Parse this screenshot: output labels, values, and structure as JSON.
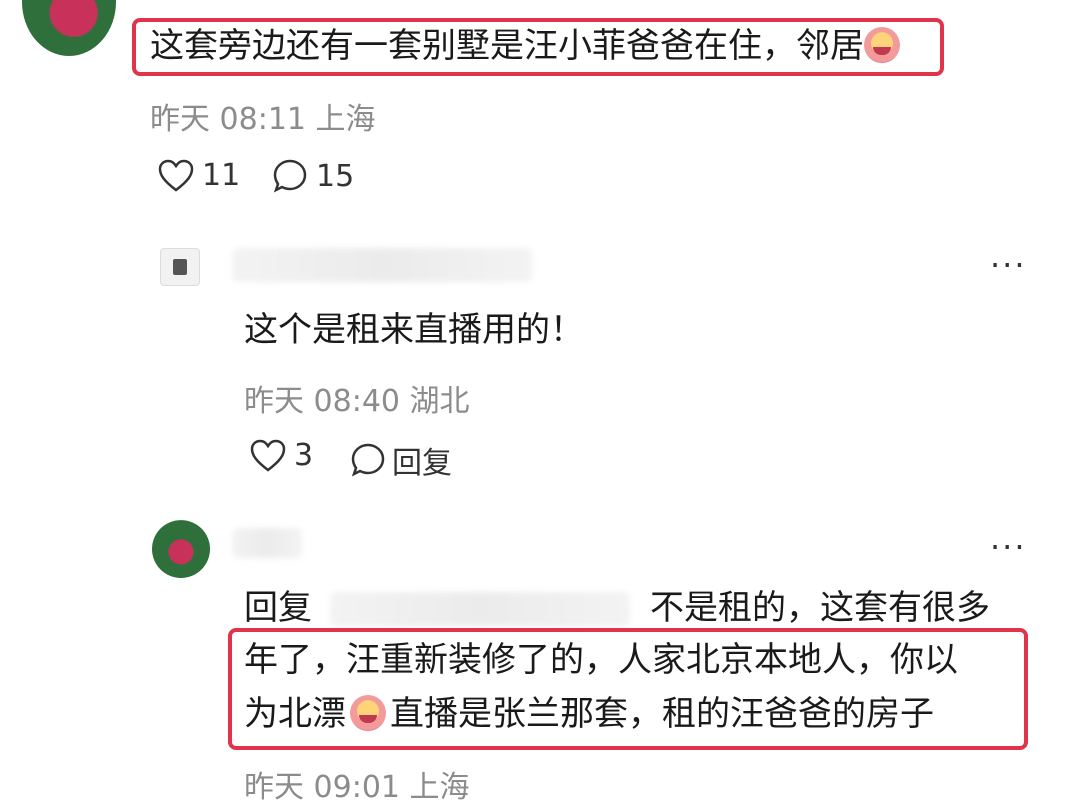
{
  "comment": {
    "text": "这套旁边还有一套别墅是汪小菲爸爸在住，邻居",
    "emoji": "crying-face-emoji",
    "meta": "昨天 08:11 上海",
    "likes": "11",
    "replies": "15"
  },
  "reply1": {
    "text": "这个是租来直播用的！",
    "meta": "昨天 08:40 湖北",
    "likes": "3",
    "reply_label": "回复",
    "more": "···"
  },
  "reply2": {
    "prefix": "回复",
    "line1": "不是租的，这套有很多",
    "line2": "年了，汪重新装修了的，人家北京本地人，你以",
    "line3a": "为北漂",
    "line3b": "直播是张兰那套，租的汪爸爸的房子",
    "meta": "昨天 09:01 上海",
    "more": "···"
  },
  "colors": {
    "highlight": "#e0344c",
    "meta": "#8c8c8c"
  }
}
